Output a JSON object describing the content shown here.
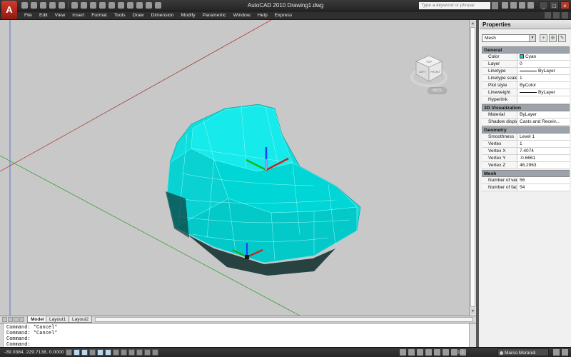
{
  "app": {
    "title": "AutoCAD 2010   Drawing1.dwg",
    "logo_letter": "A",
    "search_placeholder": "Type a keyword or phrase",
    "window_controls": [
      "_",
      "□",
      "×"
    ]
  },
  "menu": {
    "items": [
      "File",
      "Edit",
      "View",
      "Insert",
      "Format",
      "Tools",
      "Draw",
      "Dimension",
      "Modify",
      "Parametric",
      "Window",
      "Help",
      "Express"
    ]
  },
  "viewport": {
    "viewcube_faces": {
      "top": "TOP",
      "left": "LEFT",
      "front": "FRONT"
    },
    "ucs_label": "WCS",
    "model_color": "#00e0e0",
    "axis_colors": {
      "x": "#e02020",
      "y": "#20c020",
      "z": "#2050ff"
    }
  },
  "layout_tabs": [
    "Model",
    "Layout1",
    "Layout2"
  ],
  "command": {
    "lines": [
      "Command: *Cancel*",
      "Command: *Cancel*",
      "Command:",
      "Command:"
    ]
  },
  "status": {
    "coords": "-39.0384, 229.7138, 0.0000",
    "scale": "1:1",
    "workspace": "Marco Morandi"
  },
  "properties": {
    "title": "Properties",
    "selected_object": "Mesh",
    "sections": [
      {
        "name": "General",
        "rows": [
          {
            "name": "Color",
            "value": "Cyan",
            "swatch": "#00d4d4"
          },
          {
            "name": "Layer",
            "value": "0"
          },
          {
            "name": "Linetype",
            "value": "ByLayer",
            "line": true
          },
          {
            "name": "Linetype scale",
            "value": "1"
          },
          {
            "name": "Plot style",
            "value": "ByColor"
          },
          {
            "name": "Lineweight",
            "value": "ByLayer",
            "line": true
          },
          {
            "name": "Hyperlink",
            "value": ""
          }
        ]
      },
      {
        "name": "3D Visualization",
        "rows": [
          {
            "name": "Material",
            "value": "ByLayer"
          },
          {
            "name": "Shadow display",
            "value": "Casts and Receiv..."
          }
        ]
      },
      {
        "name": "Geometry",
        "rows": [
          {
            "name": "Smoothness",
            "value": "Level 1"
          },
          {
            "name": "Vertex",
            "value": "1"
          },
          {
            "name": "Vertex X",
            "value": "7.4074"
          },
          {
            "name": "Vertex Y",
            "value": "-0.6661"
          },
          {
            "name": "Vertex Z",
            "value": "46.2963"
          }
        ]
      },
      {
        "name": "Mesh",
        "rows": [
          {
            "name": "Number of vert...",
            "value": "56"
          },
          {
            "name": "Number of faces",
            "value": "54"
          }
        ]
      }
    ]
  }
}
